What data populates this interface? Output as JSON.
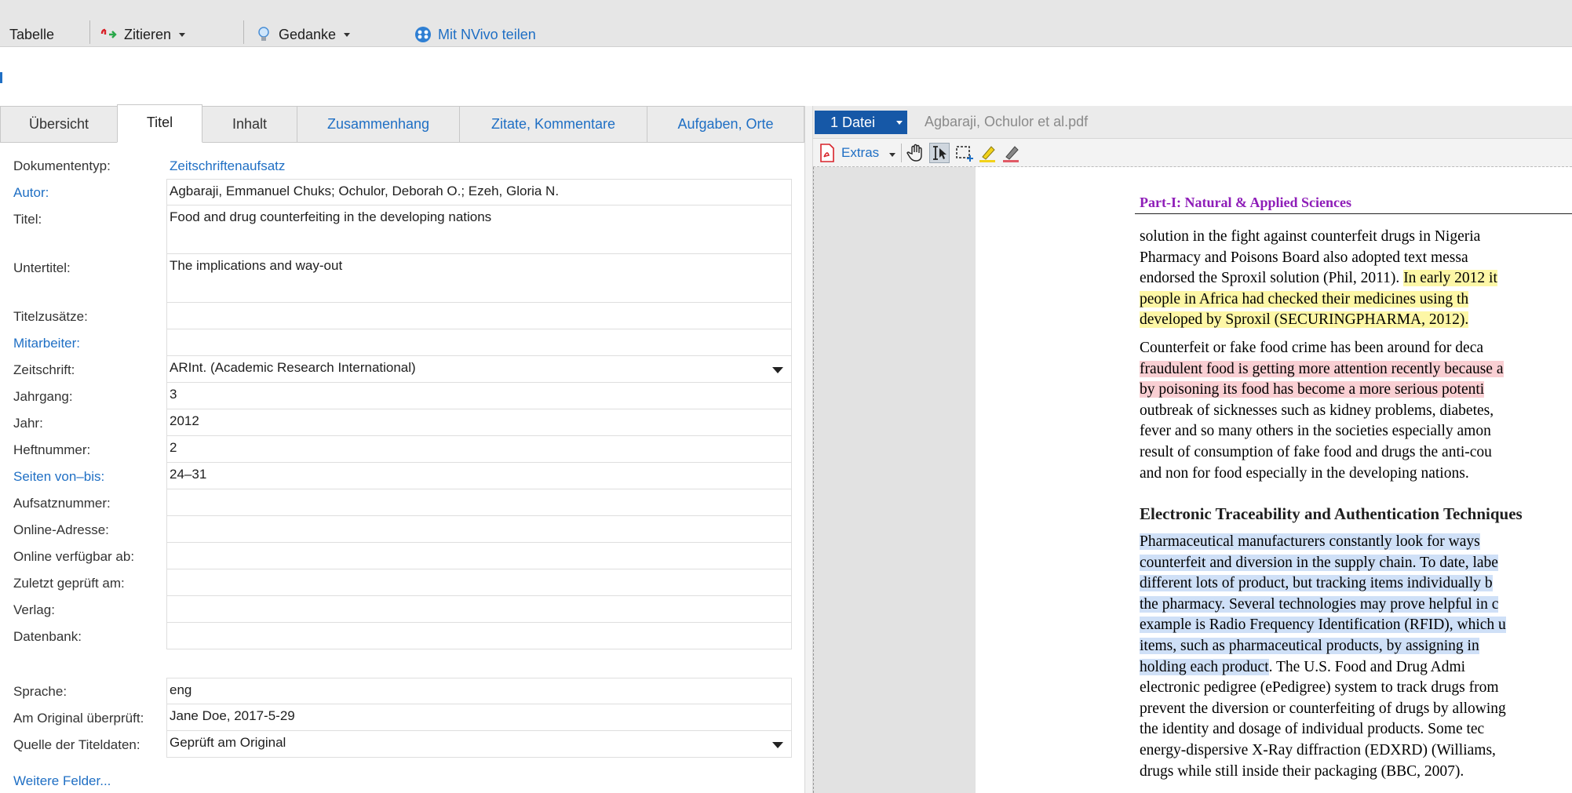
{
  "toolbar": {
    "tabelle": "Tabelle",
    "zitieren": "Zitieren",
    "gedanke": "Gedanke",
    "nvivo": "Mit NVivo teilen"
  },
  "tabs": [
    {
      "label": "Übersicht"
    },
    {
      "label": "Titel"
    },
    {
      "label": "Inhalt"
    },
    {
      "label": "Zusammenhang"
    },
    {
      "label": "Zitate, Kommentare"
    },
    {
      "label": "Aufgaben, Orte"
    }
  ],
  "form": {
    "dokumententyp": {
      "label": "Dokumententyp:",
      "value": "Zeitschriftenaufsatz"
    },
    "autor": {
      "label": "Autor:",
      "value": "Agbaraji, Emmanuel Chuks; Ochulor, Deborah O.; Ezeh, Gloria N."
    },
    "titel": {
      "label": "Titel:",
      "value": "Food and drug counterfeiting in the developing nations"
    },
    "untertitel": {
      "label": "Untertitel:",
      "value": "The implications and way-out"
    },
    "titelzusaetze": {
      "label": "Titelzusätze:",
      "value": ""
    },
    "mitarbeiter": {
      "label": "Mitarbeiter:",
      "value": ""
    },
    "zeitschrift": {
      "label": "Zeitschrift:",
      "value": "ARInt. (Academic Research International)"
    },
    "jahrgang": {
      "label": "Jahrgang:",
      "value": "3"
    },
    "jahr": {
      "label": "Jahr:",
      "value": "2012"
    },
    "heftnummer": {
      "label": "Heftnummer:",
      "value": "2"
    },
    "seiten": {
      "label": "Seiten von–bis:",
      "value": "24–31"
    },
    "aufsatznummer": {
      "label": "Aufsatznummer:",
      "value": ""
    },
    "online_adresse": {
      "label": "Online-Adresse:",
      "value": ""
    },
    "online_verfuegbar": {
      "label": "Online verfügbar ab:",
      "value": ""
    },
    "zuletzt_geprueft": {
      "label": "Zuletzt geprüft am:",
      "value": ""
    },
    "verlag": {
      "label": "Verlag:",
      "value": ""
    },
    "datenbank": {
      "label": "Datenbank:",
      "value": ""
    },
    "sprache": {
      "label": "Sprache:",
      "value": "eng"
    },
    "original_geprueft": {
      "label": "Am Original überprüft:",
      "value": "Jane Doe, 2017-5-29"
    },
    "quelle": {
      "label": "Quelle der Titeldaten:",
      "value": "Geprüft am Original"
    },
    "weitere": "Weitere Felder..."
  },
  "viewer": {
    "file_button": "1 Datei",
    "file_name": "Agbaraji, Ochulor et al.pdf",
    "extras": "Extras",
    "tools": [
      "pdf-icon",
      "hand-tool-icon",
      "text-select-icon",
      "area-select-icon",
      "highlighter-yellow-icon",
      "highlighter-red-icon"
    ],
    "page_header": "Part-I: Natural & Applied Sciences",
    "para1": [
      "solution in the fight against counterfeit drugs in Nigeria",
      "Pharmacy and Poisons Board also adopted text messa",
      "endorsed the Sproxil solution (Phil, 2011). ",
      "In early 2012 it",
      "people in Africa had checked their medicines using th",
      "developed by Sproxil (SECURINGPHARMA, 2012)."
    ],
    "para2": [
      "Counterfeit or fake food crime has been around for deca",
      "fraudulent food is getting more attention recently because a",
      "by poisoning its food has become a more serious potenti",
      "outbreak of sicknesses such as kidney problems, diabetes,",
      "fever and so many others in the societies especially amon",
      "result of consumption of fake food and drugs the anti-cou",
      "and non for food especially in the developing nations."
    ],
    "heading2": "Electronic Traceability and Authentication Techniques",
    "para3": [
      "Pharmaceutical manufacturers constantly look for ways",
      "counterfeit and diversion in the supply chain. To date, labe",
      "different lots of product, but tracking items individually b",
      "the pharmacy. Several technologies may prove helpful in c",
      "example is Radio Frequency Identification (RFID), which u",
      "items, such as pharmaceutical products, by assigning in",
      "holding each product",
      ". The U.S. Food and Drug Admi",
      "electronic pedigree (ePedigree) system to track drugs from",
      "prevent the diversion or counterfeiting of drugs by allowing",
      "the identity and dosage of individual products. Some tec",
      "energy-dispersive X-Ray diffraction (EDXRD) (Williams,",
      "drugs while still inside their packaging (BBC, 2007)."
    ],
    "colors": {
      "highlight_yellow": "#fdf7a6",
      "highlight_red": "#f9cfd3",
      "highlight_blue": "#cfe0f7",
      "header_purple": "#8e1db8",
      "accent_blue": "#1658a7"
    }
  }
}
